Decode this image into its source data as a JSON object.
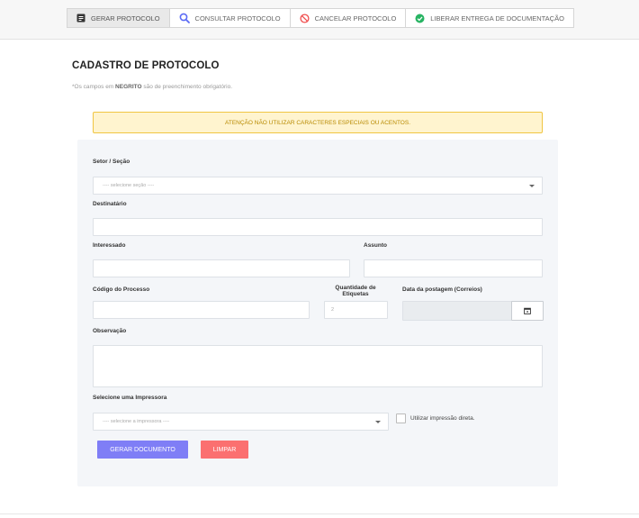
{
  "tabs": [
    {
      "label": "GERAR PROTOCOLO",
      "icon": "document-icon",
      "active": true
    },
    {
      "label": "CONSULTAR PROTOCOLO",
      "icon": "search-icon",
      "active": false
    },
    {
      "label": "CANCELAR PROTOCOLO",
      "icon": "ban-icon",
      "active": false
    },
    {
      "label": "LIBERAR ENTREGA DE DOCUMENTAÇÃO",
      "icon": "check-circle-icon",
      "active": false
    }
  ],
  "colors": {
    "accent_blue": "#5b6bf5",
    "danger": "#f04d4d",
    "success": "#28b463",
    "doc_icon": "#333333"
  },
  "page": {
    "title": "CADASTRO DE PROTOCOLO",
    "subtitle_prefix": "*Os campos em ",
    "subtitle_bold": "NEGRITO",
    "subtitle_suffix": " são de preenchimento obrigatório."
  },
  "alert": "ATENÇÃO NÃO UTILIZAR CARACTERES ESPECIAIS OU ACENTOS.",
  "form": {
    "setor_label": "Setor / Seção",
    "setor_placeholder": "---- selecione seção ----",
    "destinatario_label": "Destinatário",
    "destinatario_value": "",
    "interessado_label": "Interessado",
    "interessado_value": "",
    "assunto_label": "Assunto",
    "assunto_value": "",
    "codigo_label": "Código do Processo",
    "codigo_value": "",
    "quantidade_label_line1": "Quantidade de",
    "quantidade_label_line2": "Etiquetas",
    "quantidade_value": "2",
    "data_label": "Data da postagem (Correios)",
    "data_value": "",
    "observacao_label": "Observação",
    "observacao_value": "",
    "impressora_label": "Selecione uma Impressora",
    "impressora_placeholder": "---- selecione a impressora ----",
    "impressao_direta_label": "Utilizar impressão direta."
  },
  "buttons": {
    "gerar": "GERAR DOCUMENTO",
    "limpar": "LIMPAR"
  }
}
